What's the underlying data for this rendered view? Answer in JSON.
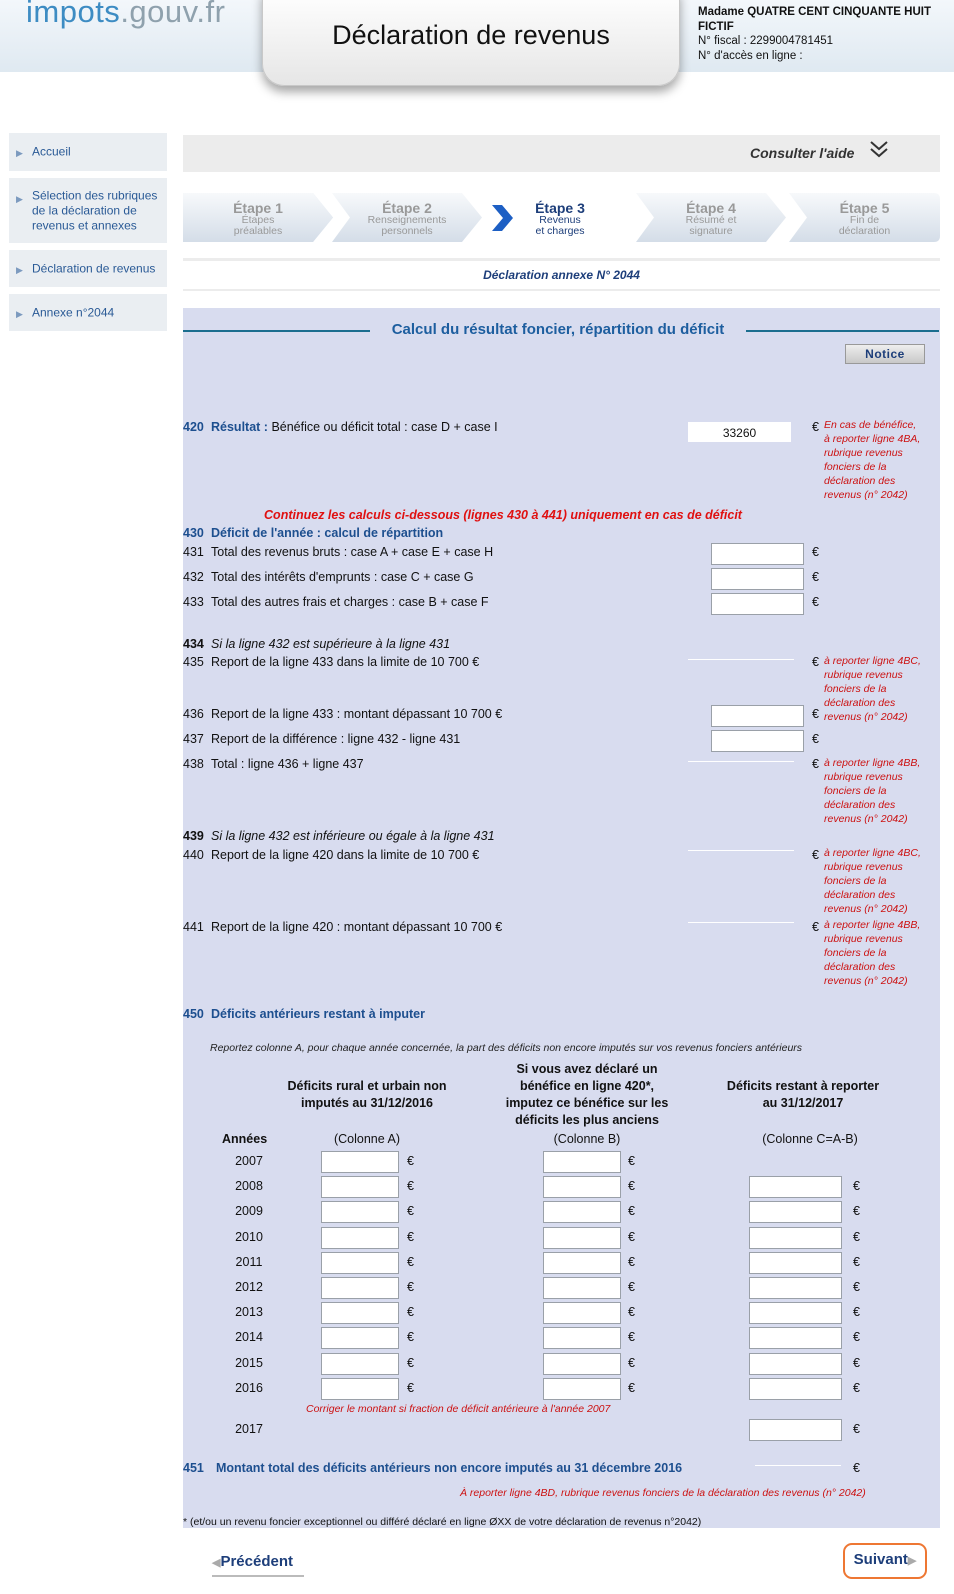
{
  "header": {
    "logo_main": "impots",
    "logo_suffix": ".gouv.fr",
    "title": "Déclaration de revenus",
    "user_name": "Madame QUATRE CENT CINQUANTE HUIT FICTIF",
    "fiscal_number": "N° fiscal : 2299004781451",
    "access_number": "N° d'accès en ligne :"
  },
  "sidebar": {
    "items": [
      {
        "label": "Accueil"
      },
      {
        "label": "Sélection des rubriques de la déclaration de revenus et annexes"
      },
      {
        "label": "Déclaration de revenus"
      },
      {
        "label": "Annexe n°2044"
      }
    ]
  },
  "help": {
    "label": "Consulter l'aide"
  },
  "steps": [
    {
      "num": "Étape 1",
      "label1": "Étapes",
      "label2": "préalables",
      "active": false
    },
    {
      "num": "Étape 2",
      "label1": "Renseignements",
      "label2": "personnels",
      "active": false
    },
    {
      "num": "Étape 3",
      "label1": "Revenus",
      "label2": "et charges",
      "active": true
    },
    {
      "num": "Étape 4",
      "label1": "Résumé et",
      "label2": "signature",
      "active": false
    },
    {
      "num": "Étape 5",
      "label1": "Fin de",
      "label2": "déclaration",
      "active": false
    }
  ],
  "annex_title": "Déclaration annexe N° 2044",
  "section": {
    "title": "Calcul du résultat foncier, répartition du déficit",
    "notice_label": "Notice"
  },
  "currency": "€",
  "line420": {
    "num": "420",
    "label_bold": "Résultat :",
    "label": "Bénéfice ou déficit total : case D + case I",
    "value": "33260",
    "note": [
      "En cas de bénéfice,",
      "à reporter ligne 4BA,",
      "rubrique revenus",
      "fonciers de la",
      "déclaration des",
      "revenus (n° 2042)"
    ]
  },
  "continue_msg": "Continuez les calculs ci-dessous (lignes 430 à 441) uniquement en cas de déficit",
  "line430": {
    "num": "430",
    "label": "Déficit de l'année : calcul de répartition"
  },
  "lines_a": [
    {
      "num": "431",
      "label": "Total des revenus bruts : case A + case E + case H",
      "value": ""
    },
    {
      "num": "432",
      "label": "Total des intérêts d'emprunts : case C + case G",
      "value": ""
    },
    {
      "num": "433",
      "label": "Total des autres frais et charges : case B + case F",
      "value": ""
    }
  ],
  "line434": {
    "num": "434",
    "label": "Si la ligne 432 est supérieure à la ligne 431"
  },
  "line435": {
    "num": "435",
    "label": "Report de la ligne 433 dans la limite de 10 700 €",
    "note": [
      "à reporter ligne 4BC,",
      "rubrique revenus",
      "fonciers de la",
      "déclaration des",
      "revenus (n° 2042)"
    ]
  },
  "line436": {
    "num": "436",
    "label": "Report de la ligne 433 : montant dépassant 10 700 €",
    "value": ""
  },
  "line437": {
    "num": "437",
    "label": "Report de la différence : ligne 432 - ligne 431",
    "value": ""
  },
  "line438": {
    "num": "438",
    "label": "Total : ligne 436 + ligne 437",
    "note": [
      "à reporter ligne 4BB,",
      "rubrique revenus",
      "fonciers de la",
      "déclaration des",
      "revenus (n° 2042)"
    ]
  },
  "line439": {
    "num": "439",
    "label": "Si la ligne 432 est inférieure ou égale à la ligne 431"
  },
  "line440": {
    "num": "440",
    "label": "Report de la ligne 420 dans la limite de 10 700 €",
    "note": [
      "à reporter ligne 4BC,",
      "rubrique revenus",
      "fonciers de la",
      "déclaration des",
      "revenus (n° 2042)"
    ]
  },
  "line441": {
    "num": "441",
    "label": "Report de la ligne 420 : montant dépassant 10 700 €",
    "note": [
      "à reporter ligne 4BB,",
      "rubrique revenus",
      "fonciers de la",
      "déclaration des",
      "revenus (n° 2042)"
    ]
  },
  "line450": {
    "num": "450",
    "label": "Déficits antérieurs restant à imputer"
  },
  "deficit_table": {
    "instruction": "Reportez colonne A, pour chaque année concernée, la part des déficits non encore imputés sur vos revenus fonciers antérieurs",
    "col_a_head": [
      "Déficits rural et urbain non",
      "imputés au 31/12/2016"
    ],
    "col_b_head": [
      "Si vous avez déclaré un",
      "bénéfice en ligne 420*,",
      "imputez ce bénéfice sur les",
      "déficits les plus anciens"
    ],
    "col_c_head": [
      "Déficits restant à reporter",
      "au 31/12/2017"
    ],
    "years_label": "Années",
    "col_a_sub": "(Colonne A)",
    "col_b_sub": "(Colonne B)",
    "col_c_sub": "(Colonne C=A-B)",
    "years": [
      "2007",
      "2008",
      "2009",
      "2010",
      "2011",
      "2012",
      "2013",
      "2014",
      "2015",
      "2016"
    ],
    "correction_note": "Corriger le montant si fraction de déficit antérieure à l'année 2007",
    "last_year": "2017"
  },
  "line451": {
    "num": "451",
    "label": "Montant total des déficits antérieurs non encore imputés au 31 décembre 2016",
    "note": "À reporter ligne 4BD, rubrique revenus fonciers de la déclaration des revenus (n° 2042)"
  },
  "footnote": "* (et/ou un revenu foncier exceptionnel ou différé déclaré en ligne ØXX de votre déclaration de revenus n°2042)",
  "nav": {
    "prev": "Précédent",
    "next": "Suivant"
  }
}
